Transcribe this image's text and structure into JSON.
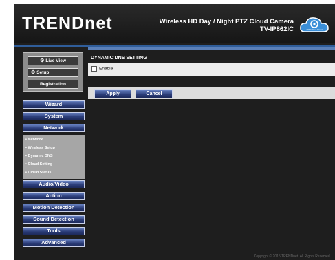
{
  "header": {
    "logo": "TRENDnet",
    "title_line1": "Wireless HD Day / Night PTZ Cloud Camera",
    "title_line2": "TV-IP862IC",
    "cloud_label": "TRENDnet Cloud"
  },
  "sidebar": {
    "top_buttons": [
      "Live View",
      "Setup",
      "Registration"
    ],
    "nav_upper": [
      "Wizard",
      "System",
      "Network"
    ],
    "network_sub": [
      "Network",
      "Wireless Setup",
      "Dynamic DNS",
      "Cloud Setting",
      "Cloud Status"
    ],
    "nav_lower": [
      "Audio/Video",
      "Action",
      "Motion Detection",
      "Sound Detection",
      "Tools",
      "Advanced"
    ]
  },
  "main": {
    "section_title": "DYNAMIC DNS SETTING",
    "enable_label": "Enable",
    "enable_checked": false,
    "apply_label": "Apply",
    "cancel_label": "Cancel"
  },
  "footer": {
    "copyright": "Copyright © 2015 TRENDnet. All Rights Reserved."
  },
  "colors": {
    "accent": "#2c3e7a",
    "accent_light": "#6a84c4",
    "background": "#1e1e1e"
  }
}
